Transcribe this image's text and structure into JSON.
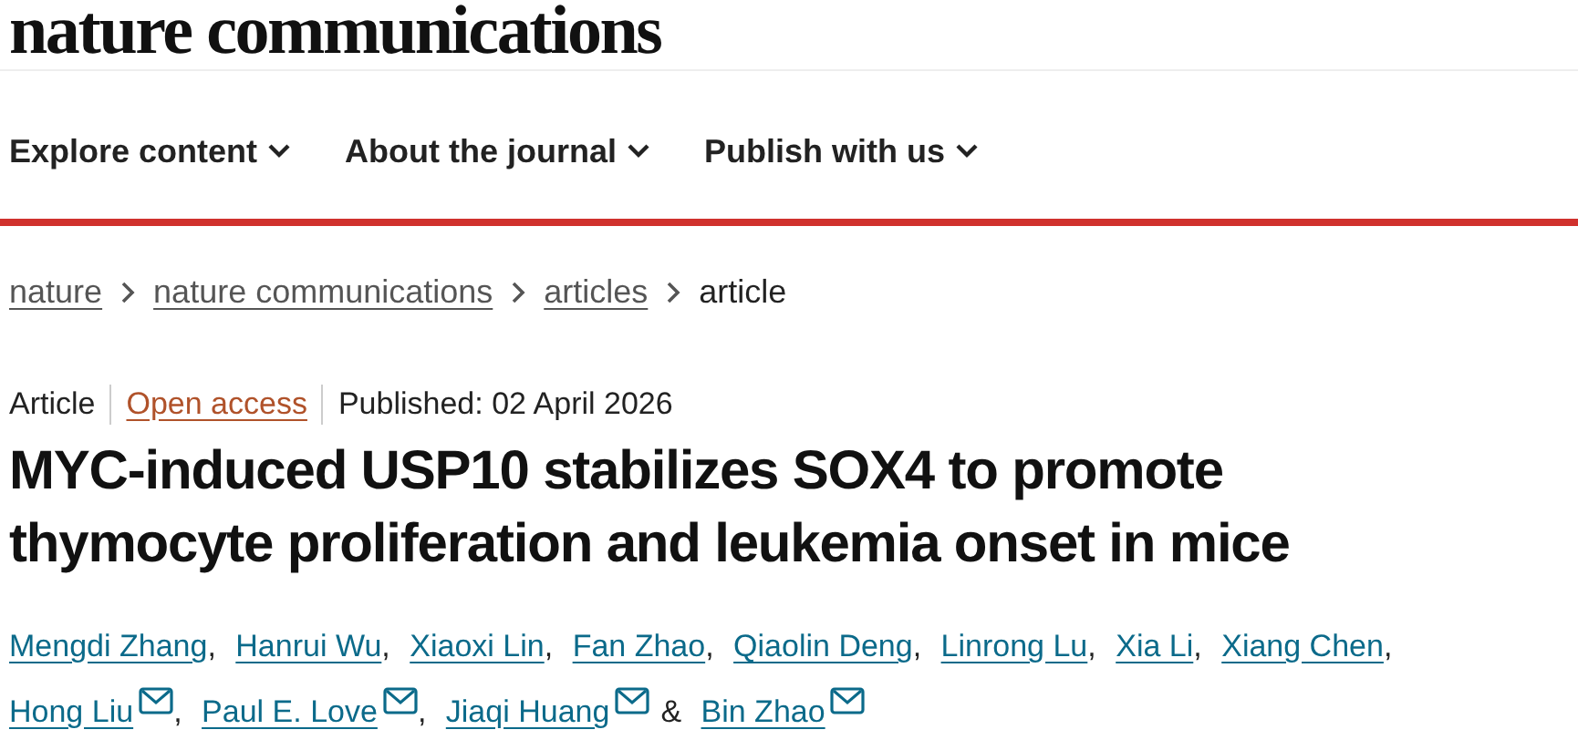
{
  "logo": "nature communications",
  "nav": [
    {
      "label": "Explore content",
      "has_menu": true
    },
    {
      "label": "About the journal",
      "has_menu": true
    },
    {
      "label": "Publish with us",
      "has_menu": true
    }
  ],
  "breadcrumbs": [
    {
      "label": "nature",
      "link": true
    },
    {
      "label": "nature communications",
      "link": true
    },
    {
      "label": "articles",
      "link": true
    },
    {
      "label": "article",
      "link": false
    }
  ],
  "meta": {
    "type": "Article",
    "access": "Open access",
    "published": "Published: 02 April 2026"
  },
  "title": "MYC-induced USP10 stabilizes SOX4 to promote thymocyte proliferation and leukemia onset in mice",
  "authors": [
    {
      "name": "Mengdi Zhang",
      "email": false,
      "joiner": ","
    },
    {
      "name": "Hanrui Wu",
      "email": false,
      "joiner": ","
    },
    {
      "name": "Xiaoxi Lin",
      "email": false,
      "joiner": ","
    },
    {
      "name": "Fan Zhao",
      "email": false,
      "joiner": ","
    },
    {
      "name": "Qiaolin Deng",
      "email": false,
      "joiner": ","
    },
    {
      "name": "Linrong Lu",
      "email": false,
      "joiner": ","
    },
    {
      "name": "Xia Li",
      "email": false,
      "joiner": ","
    },
    {
      "name": "Xiang Chen",
      "email": false,
      "joiner": ","
    },
    {
      "name": "Hong Liu",
      "email": true,
      "joiner": ","
    },
    {
      "name": "Paul E. Love",
      "email": true,
      "joiner": ","
    },
    {
      "name": "Jiaqi Huang",
      "email": true,
      "joiner": "&"
    },
    {
      "name": "Bin Zhao",
      "email": true
    }
  ]
}
